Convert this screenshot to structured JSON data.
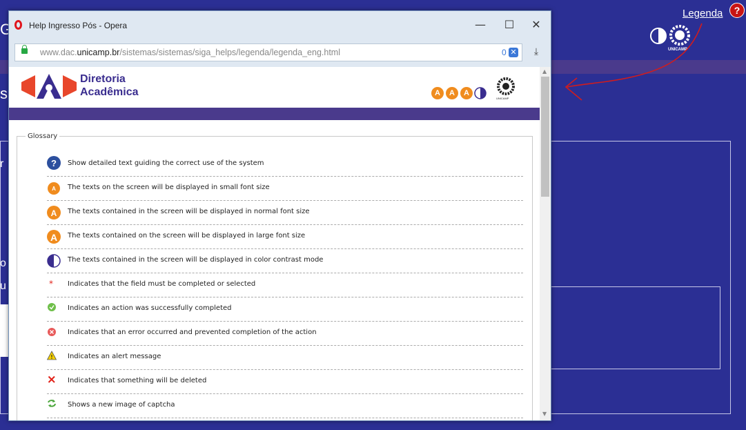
{
  "background": {
    "legenda_link": "Legenda",
    "help_icon": "?",
    "unicamp_label": "UNICAMP",
    "partial_texts": [
      "Ge",
      "s",
      "r",
      "o",
      "u"
    ]
  },
  "popup": {
    "window_title": "Help Ingresso Pós - Opera",
    "controls": {
      "minimize": "—",
      "maximize": "☐",
      "close": "✕"
    },
    "url": {
      "prefix": "www.dac.",
      "host": "unicamp.br",
      "path": "/sistemas/sistemas/siga_helps/legenda/legenda_eng.html"
    },
    "extension_count": "0",
    "extension_badge": "✕",
    "download_icon": "⤓",
    "header": {
      "org_line1": "Diretoria",
      "org_line2": "Acadêmica",
      "font_buttons": [
        "A",
        "A",
        "A"
      ],
      "unicamp_small_label": "UNICAMP"
    },
    "glossary": {
      "legend": "Glossary",
      "items": [
        {
          "icon": "help-icon",
          "text": "Show detailed text guiding the correct use of the system"
        },
        {
          "icon": "small-font-icon",
          "text": "The texts on the screen will be displayed in small font size"
        },
        {
          "icon": "normal-font-icon",
          "text": "The texts contained in the screen will be displayed in normal font size"
        },
        {
          "icon": "large-font-icon",
          "text": "The texts contained on the screen will be displayed in large font size"
        },
        {
          "icon": "contrast-icon",
          "text": "The texts contained in the screen will be displayed in color contrast mode"
        },
        {
          "icon": "asterisk-icon",
          "text": "Indicates that the field must be completed or selected"
        },
        {
          "icon": "success-icon",
          "text": "Indicates an action was successfully completed"
        },
        {
          "icon": "error-icon",
          "text": "Indicates that an error occurred and prevented completion of the action"
        },
        {
          "icon": "alert-icon",
          "text": "Indicates an alert message"
        },
        {
          "icon": "delete-icon",
          "text": "Indicates that something will be deleted"
        },
        {
          "icon": "refresh-captcha-icon",
          "text": "Shows a new image of captcha"
        }
      ]
    }
  }
}
